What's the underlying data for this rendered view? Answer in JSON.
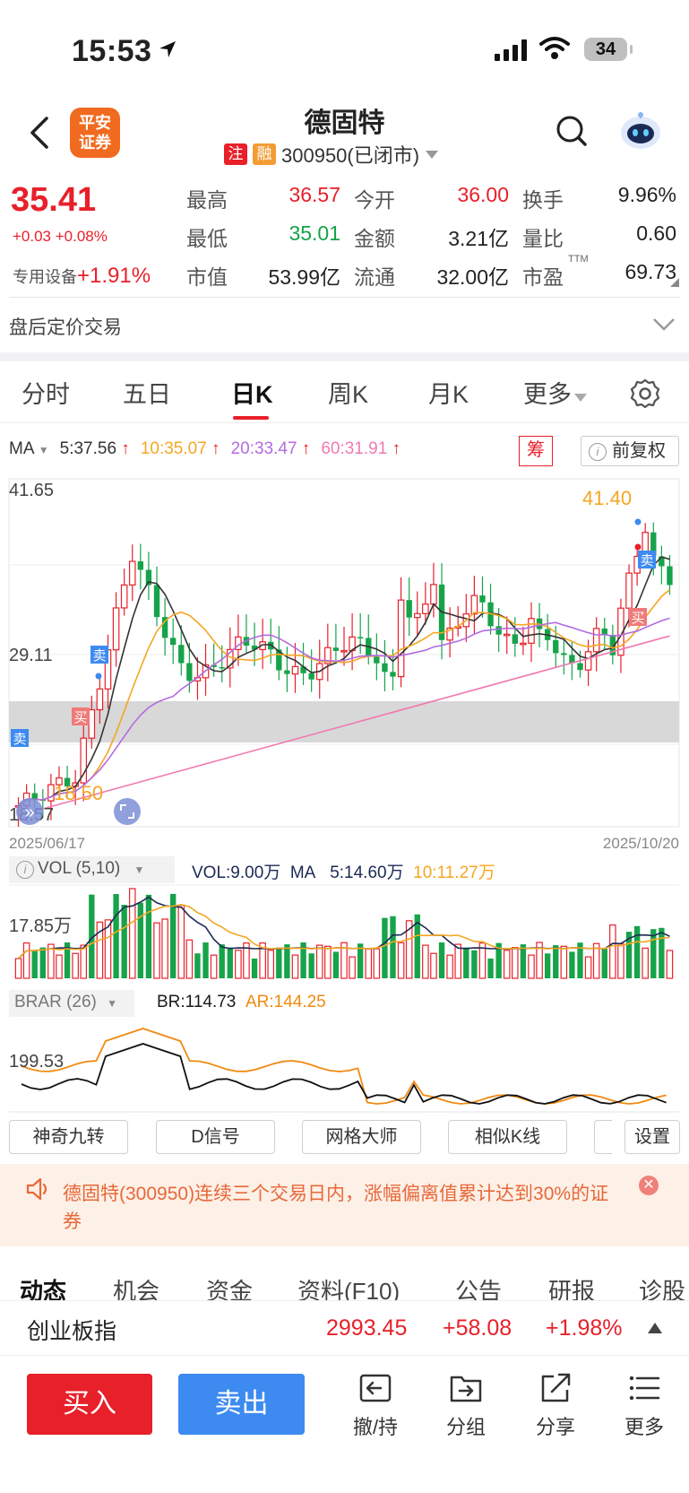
{
  "status": {
    "time": "15:53",
    "battery": "34"
  },
  "header": {
    "logo": [
      "平安",
      "证券"
    ],
    "name": "德固特",
    "tag_zhu": "注",
    "tag_rong": "融",
    "code_status": "300950(已闭市)"
  },
  "quote": {
    "price": "35.41",
    "change": "+0.03 +0.08%",
    "sector_name": "专用设备",
    "sector_change": "+1.91%",
    "rows": [
      [
        [
          "最高",
          "36.57"
        ],
        [
          "今开",
          "36.00"
        ],
        [
          "换手",
          "9.96%"
        ]
      ],
      [
        [
          "最低",
          "35.01"
        ],
        [
          "金额",
          "3.21亿"
        ],
        [
          "量比",
          "0.60"
        ]
      ],
      [
        [
          "市值",
          "53.99亿"
        ],
        [
          "流通",
          "32.00亿"
        ],
        [
          "市盈",
          "69.73"
        ]
      ]
    ],
    "pe_suffix": "TTM",
    "after_hours": "盘后定价交易"
  },
  "tabs": [
    "分时",
    "五日",
    "日K",
    "周K",
    "月K",
    "更多"
  ],
  "ma": {
    "label": "MA",
    "ma5": "5:37.56",
    "ma10": "10:35.07",
    "ma20": "20:33.47",
    "ma60": "60:31.91",
    "chou": "筹",
    "fq": "前复权",
    "colors": {
      "ma5": "#333333",
      "ma10": "#f5a623",
      "ma20": "#b36be0",
      "ma60": "#f07ab0"
    }
  },
  "kline": {
    "y_high": "41.65",
    "y_mid": "29.11",
    "y_low": "18.57",
    "hi_mark": "41.40",
    "lo_mark": "18.50",
    "date_start": "2025/06/17",
    "date_end": "2025/10/20",
    "sell": "卖",
    "buy": "买"
  },
  "vol": {
    "label": "VOL (5,10)",
    "vol": "VOL:9.00万",
    "ma_label": "MA",
    "ma5": "5:14.60万",
    "ma10": "10:11.27万",
    "y_label": "17.85万"
  },
  "brar": {
    "label": "BRAR (26)",
    "br": "BR:114.73",
    "ar": "AR:144.25",
    "y_label": "199.53"
  },
  "tools": [
    "神奇九转",
    "D信号",
    "网格大师",
    "相似K线",
    "设置"
  ],
  "notice": "德固特(300950)连续三个交易日内，涨幅偏离值累计达到30%的证券",
  "bottom_tabs": [
    "动态",
    "机会",
    "资金",
    "资料(F10)",
    "公告",
    "研报",
    "诊股"
  ],
  "index": {
    "name": "创业板指",
    "value": "2993.45",
    "change": "+58.08",
    "pct": "+1.98%"
  },
  "actions": {
    "buy": "买入",
    "sell": "卖出",
    "items": [
      "撤/持",
      "分组",
      "分享",
      "更多"
    ]
  }
}
